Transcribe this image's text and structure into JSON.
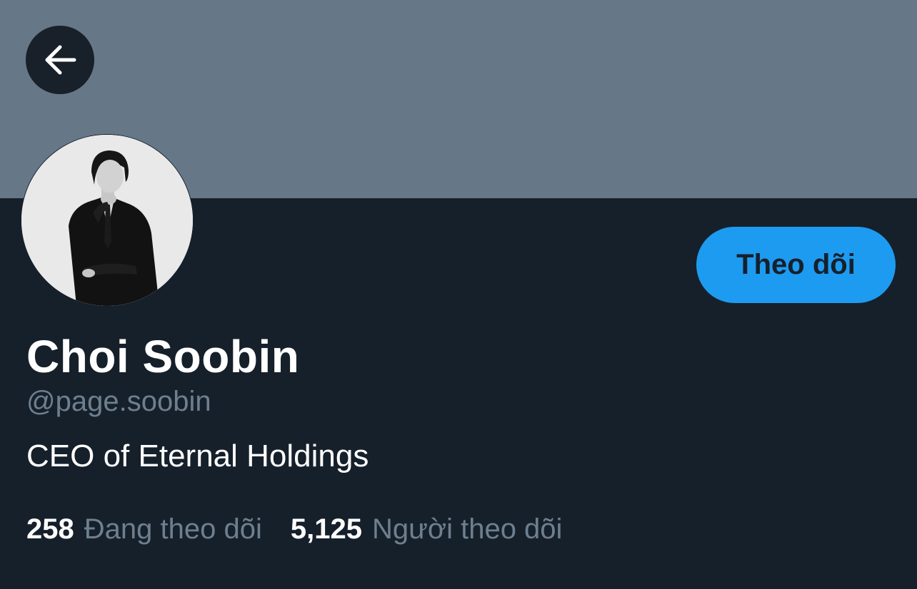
{
  "header": {
    "back_icon": "arrow-left-icon",
    "banner_color": "#667787"
  },
  "profile": {
    "display_name": "Choi Soobin",
    "handle": "@page.soobin",
    "bio": "CEO of Eternal Holdings",
    "follow_label": "Theo dõi",
    "follow_color": "#1d9bf0"
  },
  "stats": {
    "following_count": "258",
    "following_label": "Đang theo dõi",
    "followers_count": "5,125",
    "followers_label": "Người theo dõi"
  },
  "colors": {
    "background": "#16202b",
    "muted_text": "#6e7f8f"
  }
}
